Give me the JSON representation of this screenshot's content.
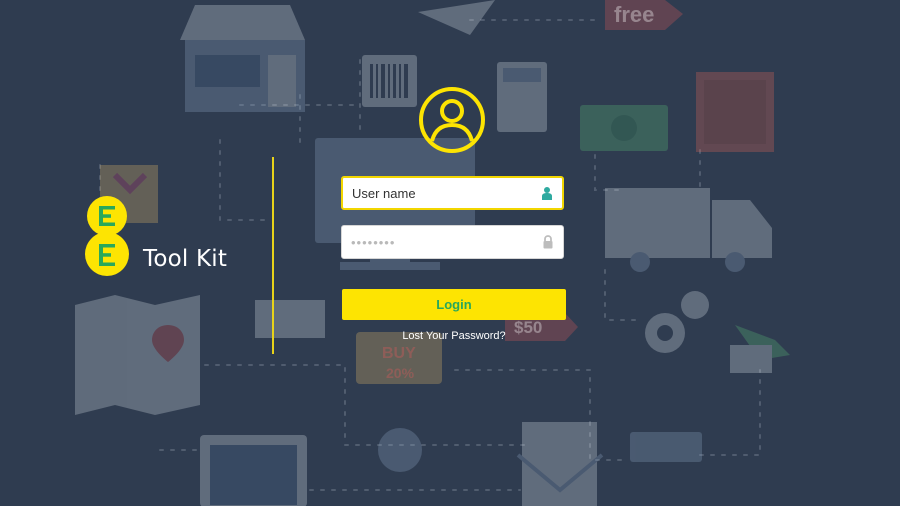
{
  "brand": {
    "product_name": "Tool Kit",
    "logo_text": "EE"
  },
  "bg_labels": {
    "free": "free",
    "price": "$50",
    "buy": "BUY",
    "discount": "20%"
  },
  "login": {
    "username_placeholder": "User name",
    "password_placeholder": "••••••••",
    "login_label": "Login",
    "lost_password_label": "Lost Your Password?"
  },
  "icons": {
    "user_field": "person-icon",
    "password_field": "lock-icon",
    "header": "user-circle-icon"
  },
  "colors": {
    "background": "#2f3c50",
    "accent": "#fde402",
    "login_text": "#29a85b"
  }
}
